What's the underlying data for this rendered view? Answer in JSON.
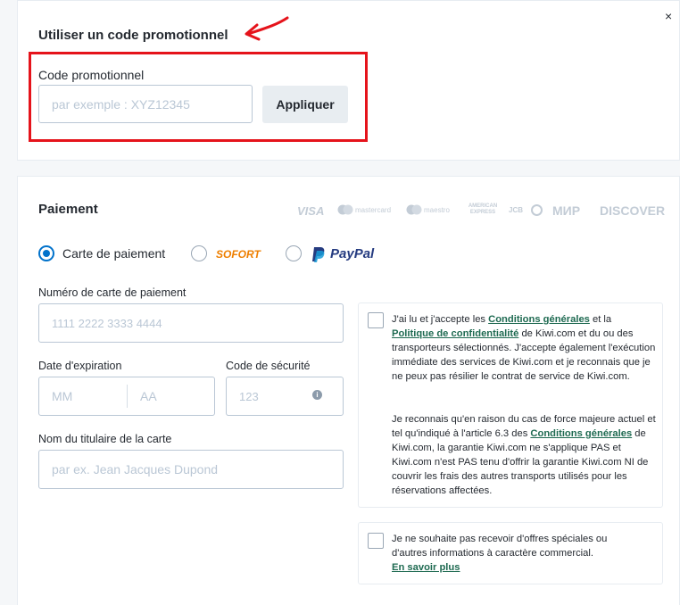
{
  "promo": {
    "title": "Utiliser un code promotionnel",
    "field_label": "Code promotionnel",
    "placeholder": "par exemple : XYZ12345",
    "apply_button": "Appliquer",
    "close": "×"
  },
  "payment": {
    "title": "Paiement",
    "brands": [
      "VISA",
      "mastercard",
      "maestro",
      "AMERICAN EXPRESS",
      "JCB",
      "Diners",
      "МИР",
      "DISCOVER"
    ],
    "methods": [
      {
        "label": "Carte de paiement",
        "selected": true
      },
      {
        "label": "SOFORT",
        "selected": false
      },
      {
        "label": "PayPal",
        "selected": false
      }
    ],
    "card_number_label": "Numéro de carte de paiement",
    "card_number_placeholder": "1111 2222 3333 4444",
    "expiry_label": "Date d'expiration",
    "expiry_month_placeholder": "MM",
    "expiry_year_placeholder": "AA",
    "cvv_label": "Code de sécurité",
    "cvv_placeholder": "123",
    "holder_label": "Nom du titulaire de la carte",
    "holder_placeholder": "par ex. Jean Jacques Dupond"
  },
  "consent": {
    "terms_p1_a": "J'ai lu et j'accepte les ",
    "terms_link1": "Conditions générales",
    "terms_p1_b": " et la ",
    "terms_link2": "Politique de confidentialité",
    "terms_p1_c": " de Kiwi.com et du ou des transporteurs sélectionnés. J'accepte également l'exécution immédiate des services de Kiwi.com et je reconnais que je ne peux pas résilier le contrat de service de Kiwi.com.",
    "terms_p2_a": "Je reconnais qu'en raison du cas de force majeure actuel et tel qu'indiqué à l'article 6.3 des ",
    "terms_link3": "Conditions générales",
    "terms_p2_b": " de Kiwi.com, la garantie Kiwi.com ne s'applique PAS et Kiwi.com n'est PAS tenu d'offrir la garantie Kiwi.com NI de couvrir les frais des autres transports utilisés pour les réservations affectées.",
    "offers_text": "Je ne souhaite pas recevoir d'offres spéciales ou d'autres informations à caractère commercial.",
    "offers_link": "En savoir plus"
  },
  "annotation_color": "#e5131b",
  "accent_color": "#0172cb"
}
